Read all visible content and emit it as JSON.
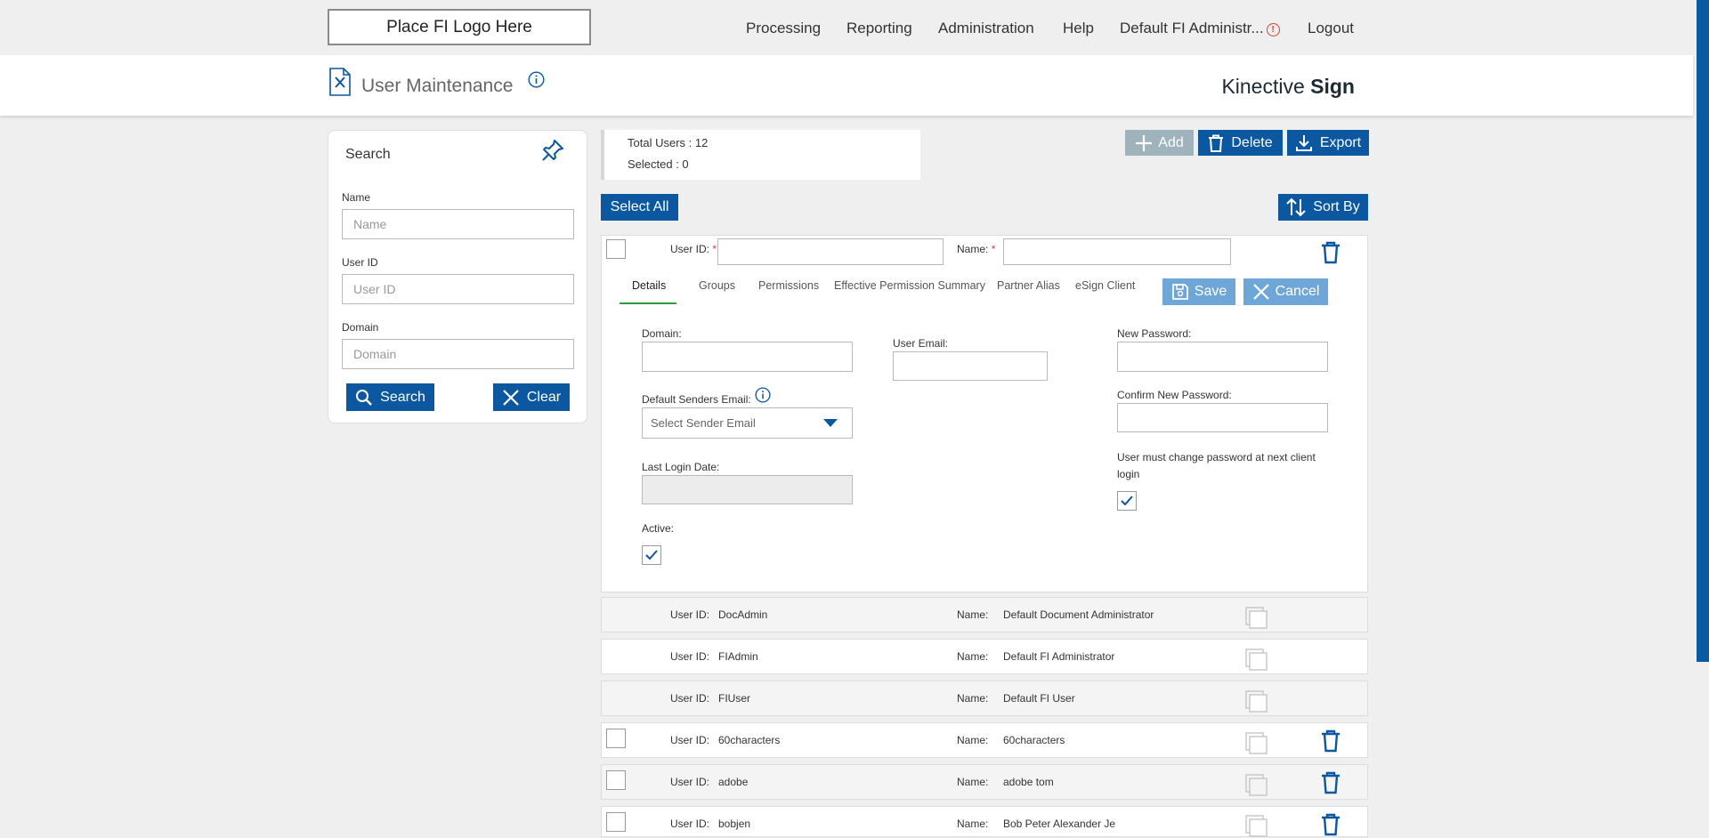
{
  "topnav": {
    "logo_text": "Place FI Logo Here",
    "items": [
      "Processing",
      "Reporting",
      "Administration",
      "Help",
      "Default FI Administr...",
      "Logout"
    ]
  },
  "header": {
    "title": "User Maintenance",
    "brand_a": "Kinective ",
    "brand_b": "Sign"
  },
  "search": {
    "title": "Search",
    "name_label": "Name",
    "name_placeholder": "Name",
    "userid_label": "User ID",
    "userid_placeholder": "User ID",
    "domain_label": "Domain",
    "domain_placeholder": "Domain",
    "search_button": "Search",
    "clear_button": "Clear"
  },
  "summary": {
    "total_users": "Total Users : 12",
    "selected": "Selected : 0"
  },
  "toolbar": {
    "add": "Add",
    "delete": "Delete",
    "export": "Export",
    "select_all": "Select All",
    "sort_by": "Sort By"
  },
  "editor": {
    "userid_label": "User ID:",
    "name_label": "Name:",
    "required_mark": "*",
    "tabs": [
      "Details",
      "Groups",
      "Permissions",
      "Effective Permission Summary",
      "Partner Alias",
      "eSign Client"
    ],
    "save": "Save",
    "cancel": "Cancel",
    "domain_label": "Domain:",
    "user_email_label": "User Email:",
    "new_password_label": "New Password:",
    "default_senders_label": "Default Senders Email:",
    "sender_placeholder": "Select Sender Email",
    "confirm_password_label": "Confirm New Password:",
    "must_change_label": "User must change password at next client login",
    "last_login_label": "Last Login Date:",
    "active_label": "Active:"
  },
  "users": [
    {
      "userid_label": "User ID:",
      "userid": "DocAdmin",
      "name_label": "Name:",
      "name": "Default Document Administrator",
      "deletable": false
    },
    {
      "userid_label": "User ID:",
      "userid": "FIAdmin",
      "name_label": "Name:",
      "name": "Default FI Administrator",
      "deletable": false
    },
    {
      "userid_label": "User ID:",
      "userid": "FIUser",
      "name_label": "Name:",
      "name": "Default FI User",
      "deletable": false
    },
    {
      "userid_label": "User ID:",
      "userid": "60characters",
      "name_label": "Name:",
      "name": "60characters",
      "deletable": true
    },
    {
      "userid_label": "User ID:",
      "userid": "adobe",
      "name_label": "Name:",
      "name": "adobe tom",
      "deletable": true
    },
    {
      "userid_label": "User ID:",
      "userid": "bobjen",
      "name_label": "Name:",
      "name": "Bob Peter Alexander Je",
      "deletable": true
    }
  ],
  "colors": {
    "primary": "#0b57a0",
    "light_button": "#6fa6d8",
    "disabled_button": "#9fb3bd",
    "alert": "#e03c31"
  }
}
